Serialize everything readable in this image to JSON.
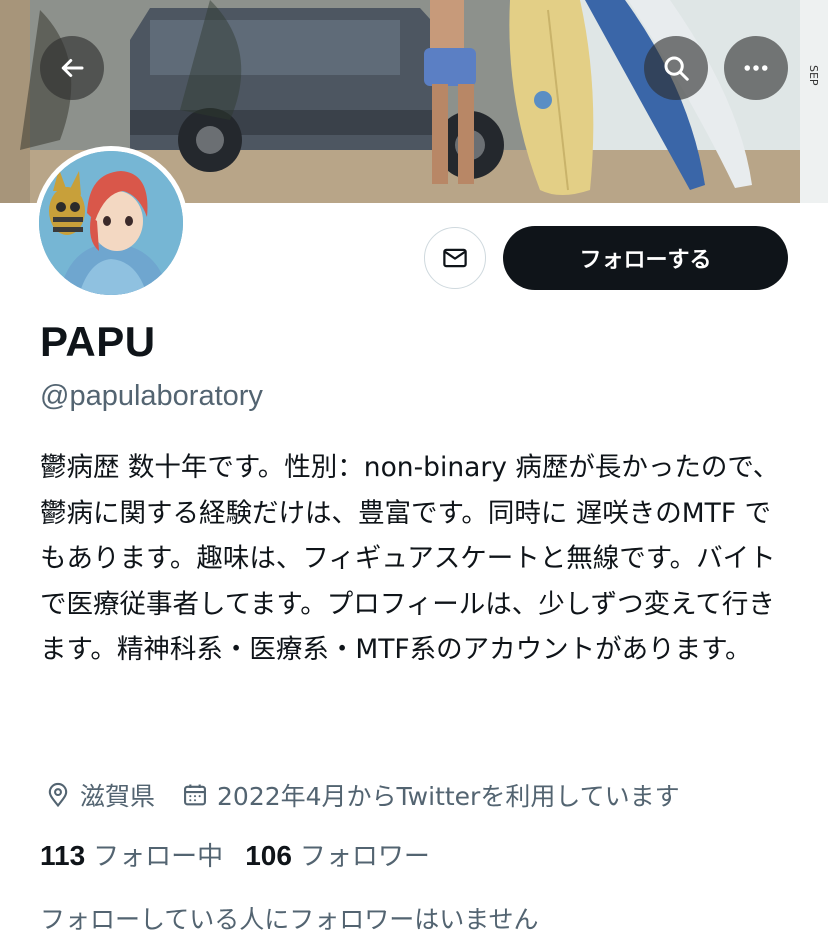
{
  "header": {
    "back_icon": "arrow-left-icon",
    "search_icon": "search-icon",
    "more_icon": "more-horizontal-icon",
    "banner_text": "SEP"
  },
  "profile": {
    "name": "PAPU",
    "handle": "@papulaboratory",
    "bio": "鬱病歴 数十年です。性別：non-binary 病歴が長かったので、鬱病に関する経験だけは、豊富です。同時に 遅咲きのMTF でもあります。趣味は、フィギュアスケートと無線です。バイトで医療従事者してます。プロフィールは、少しずつ変えて行きます。精神科系・医療系・MTF系のアカウントがあります。",
    "location": "滋賀県",
    "joined": "2022年4月からTwitterを利用しています",
    "location_icon": "location-pin-icon",
    "calendar_icon": "calendar-icon"
  },
  "actions": {
    "message_icon": "mail-icon",
    "follow_label": "フォローする"
  },
  "stats": {
    "following_count": "113",
    "following_label": "フォロー中",
    "followers_count": "106",
    "followers_label": "フォロワー"
  },
  "followers_you_know": "フォローしている人にフォロワーはいません",
  "colors": {
    "text": "#0f1419",
    "secondary": "#536471",
    "follow_button_bg": "#0f1419"
  }
}
